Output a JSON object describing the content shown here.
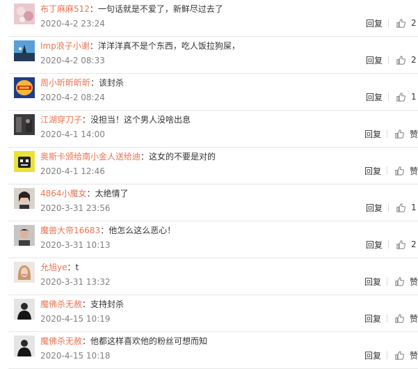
{
  "comments": [
    {
      "user": "布丁麻麻512",
      "sep": "：",
      "text": "一句话就是不爱了，新鲜尽过去了",
      "time": "2020-4-2 23:24",
      "reply": "回复",
      "likes": "2",
      "avatar": "pink-floral-avatar"
    },
    {
      "user": "Imp浪子小谢",
      "sep": "：",
      "text": "洋洋洋真不是个东西，吃人饭拉狗屎，",
      "time": "2020-4-2 08:33",
      "reply": "回复",
      "likes": "2",
      "avatar": "blue-sky-avatar"
    },
    {
      "user": "周小昕昕昕昕",
      "sep": "：",
      "text": "该封杀",
      "time": "2020-4-2 08:24",
      "reply": "回复",
      "likes": "1",
      "avatar": "burger-king-logo-avatar"
    },
    {
      "user": "江湖穿刀子",
      "sep": "：",
      "text": "没担当！这个男人没啥出息",
      "time": "2020-4-1 14:00",
      "reply": "回复",
      "likes": "赞",
      "avatar": "dark-street-avatar"
    },
    {
      "user": "奥斯卡颁给南小金人送给迪",
      "sep": "：",
      "text": "这女的不要是对的",
      "time": "2020-4-1 12:46",
      "reply": "回复",
      "likes": "赞",
      "avatar": "yellow-cartoon-avatar"
    },
    {
      "user": "4864小魔女",
      "sep": "：",
      "text": "太绝情了",
      "time": "2020-3-31 23:56",
      "reply": "回复",
      "likes": "1",
      "avatar": "woman-portrait-avatar"
    },
    {
      "user": "魔兽大帝16683",
      "sep": "：",
      "text": "他怎么这么恶心！",
      "time": "2020-3-31 10:13",
      "reply": "回复",
      "likes": "2",
      "avatar": "man-portrait-avatar"
    },
    {
      "user": "允旭ye",
      "sep": "：",
      "text": "t",
      "time": "2020-3-31 13:32",
      "reply": "回复",
      "likes": "赞",
      "avatar": "blonde-portrait-avatar"
    },
    {
      "user": "魔佛杀无赦",
      "sep": "：",
      "text": "支持封杀",
      "time": "2020-4-15 10:19",
      "reply": "回复",
      "likes": "赞",
      "avatar": "dark-figure-avatar"
    },
    {
      "user": "魔佛杀无赦",
      "sep": "：",
      "text": "他都这样喜欢他的粉丝可想而知",
      "time": "2020-4-15 10:18",
      "reply": "回复",
      "likes": "赞",
      "avatar": "dark-figure-avatar"
    }
  ],
  "colors": {
    "username": "#eb7350",
    "text": "#333333",
    "time": "#808080",
    "divider": "#e6e6e6"
  },
  "icons": {
    "like": "thumbs-up-icon"
  }
}
